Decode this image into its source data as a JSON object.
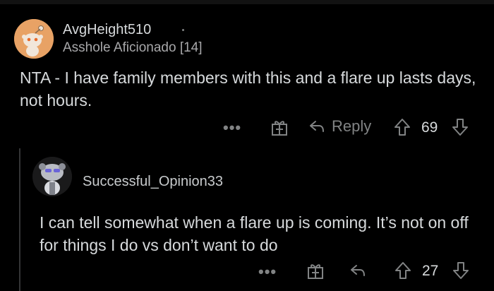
{
  "comments": [
    {
      "username": "AvgHeight510",
      "flair": "Asshole Aficionado [14]",
      "body": "NTA - I have family members with this and a flare up lasts days, not hours.",
      "actions": {
        "reply_label": "Reply",
        "score": "69"
      }
    },
    {
      "username": "Successful_Opinion33",
      "body": "I can tell somewhat when a flare up is coming. It’s not on off for things I do vs don’t want to do",
      "actions": {
        "score": "27"
      }
    }
  ],
  "icons": {
    "more": "•••",
    "award": "gift-icon",
    "reply": "reply-arrow-icon",
    "upvote": "arrow-up-icon",
    "downvote": "arrow-down-icon"
  },
  "colors": {
    "background": "#000000",
    "text": "#d7dadc",
    "muted": "#818384",
    "avatar1_bg": "#e8a265"
  }
}
